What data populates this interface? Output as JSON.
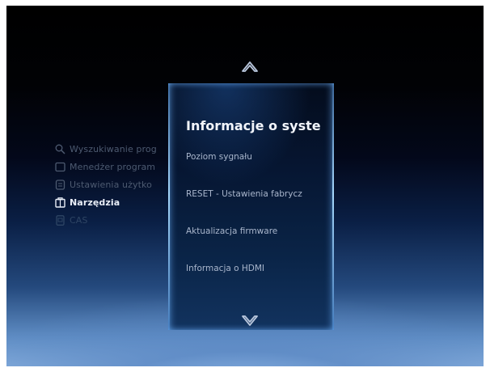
{
  "left_menu": {
    "items": [
      {
        "label": "Wyszukiwanie prog",
        "icon": "search-icon",
        "state": "dim"
      },
      {
        "label": "Menedżer program",
        "icon": "tv-icon",
        "state": "dim"
      },
      {
        "label": "Ustawienia użytko",
        "icon": "settings-icon",
        "state": "dim"
      },
      {
        "label": "Narzędzia",
        "icon": "toolbox-icon",
        "state": "active"
      },
      {
        "label": "CAS",
        "icon": "card-icon",
        "state": "dim"
      }
    ]
  },
  "submenu": {
    "title": "Informacje o syste",
    "items": [
      {
        "label": "Poziom sygnału"
      },
      {
        "label": "RESET - Ustawienia fabrycz"
      },
      {
        "label": "Aktualizacja firmware"
      },
      {
        "label": "Informacja o HDMI"
      }
    ]
  },
  "colors": {
    "active_text": "#e9eef7",
    "dim_text": "#4d5a70",
    "panel_glow": "#6eb4ff"
  }
}
